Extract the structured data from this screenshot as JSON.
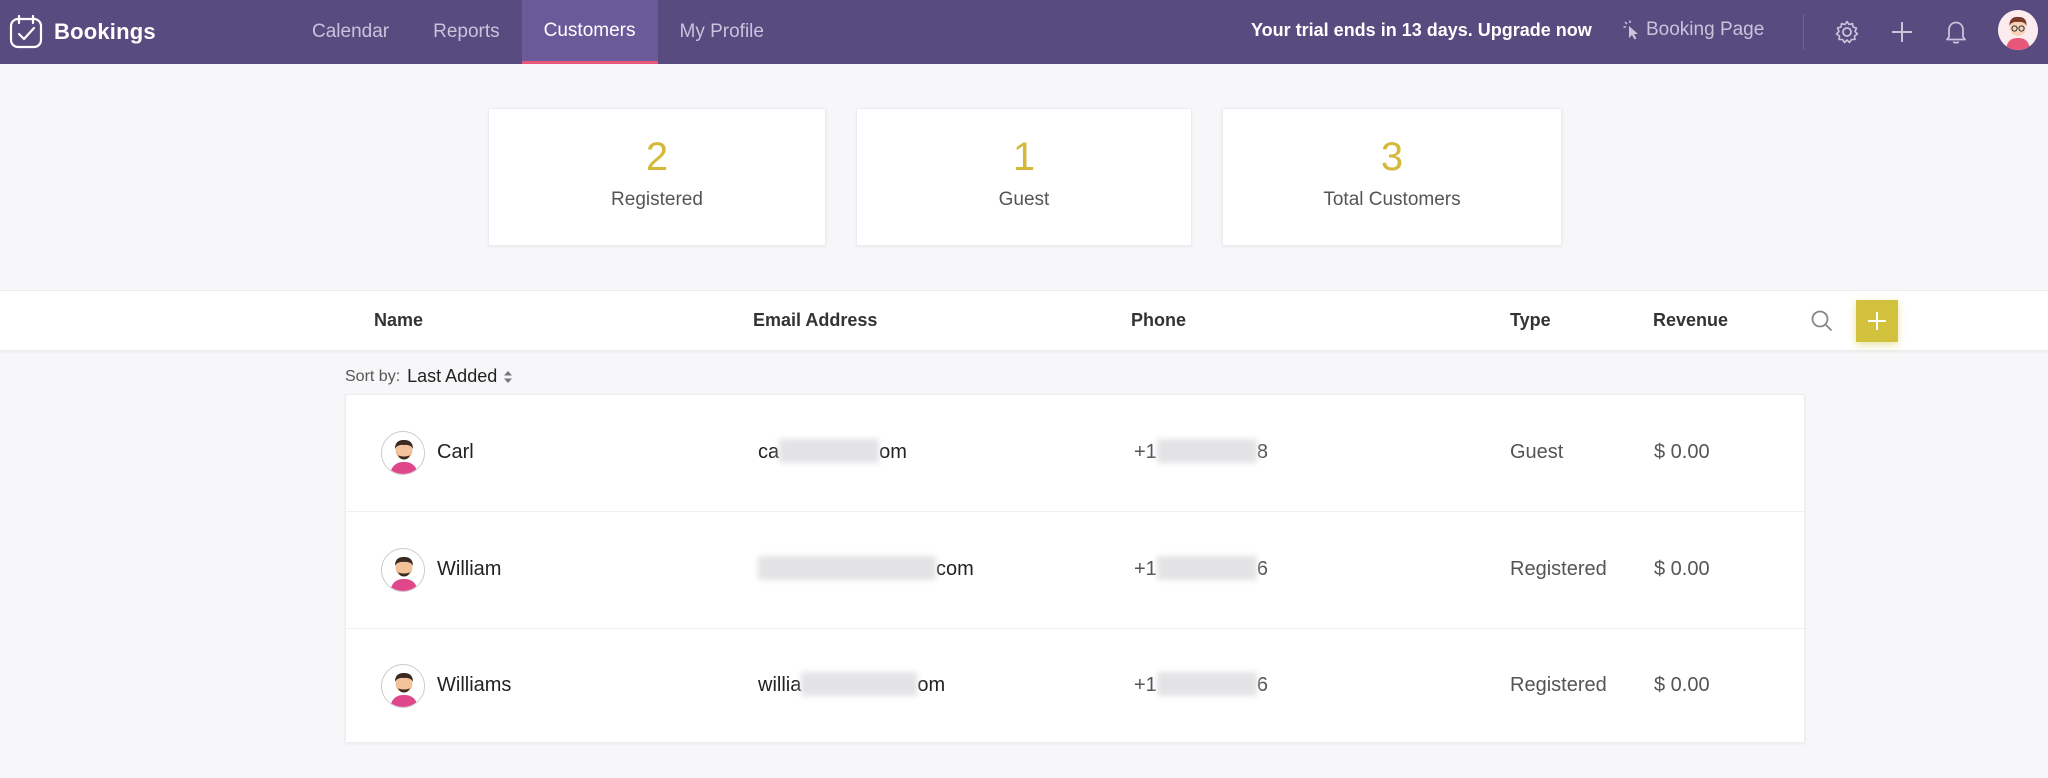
{
  "app": {
    "name": "Bookings"
  },
  "nav": {
    "items": [
      {
        "label": "Calendar",
        "active": false
      },
      {
        "label": "Reports",
        "active": false
      },
      {
        "label": "Customers",
        "active": true
      },
      {
        "label": "My Profile",
        "active": false
      }
    ]
  },
  "topbar": {
    "trial_text": "Your trial ends in 13 days. Upgrade now",
    "booking_page_label": "Booking Page",
    "icons": [
      "settings-icon",
      "plus-icon",
      "bell-icon",
      "avatar"
    ]
  },
  "stats": [
    {
      "value": "2",
      "label": "Registered"
    },
    {
      "value": "1",
      "label": "Guest"
    },
    {
      "value": "3",
      "label": "Total Customers"
    }
  ],
  "table": {
    "columns": [
      "Name",
      "Email Address",
      "Phone",
      "Type",
      "Revenue"
    ],
    "sort_label": "Sort by:",
    "sort_value": "Last Added",
    "rows": [
      {
        "name": "Carl",
        "email_prefix": "ca",
        "email_suffix": "om",
        "phone_prefix": "+1",
        "phone_suffix": "8",
        "type": "Guest",
        "revenue": "$ 0.00"
      },
      {
        "name": "William",
        "email_prefix": "",
        "email_suffix": "com",
        "phone_prefix": "+1",
        "phone_suffix": "6",
        "type": "Registered",
        "revenue": "$ 0.00"
      },
      {
        "name": "Williams",
        "email_prefix": "willia",
        "email_suffix": "om",
        "phone_prefix": "+1",
        "phone_suffix": "6",
        "type": "Registered",
        "revenue": "$ 0.00"
      }
    ]
  },
  "colors": {
    "topbar": "#574b7f",
    "active_tab": "#6b5a9a",
    "accent_yellow": "#d4b83a",
    "active_underline": "#e8577a"
  }
}
